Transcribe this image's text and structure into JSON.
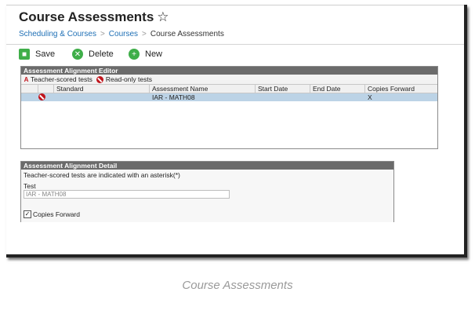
{
  "header": {
    "title": "Course Assessments",
    "star_icon": "☆",
    "breadcrumb": [
      "Scheduling & Courses",
      "Courses",
      "Course Assessments"
    ]
  },
  "toolbar": {
    "save_label": "Save",
    "delete_label": "Delete",
    "new_label": "New"
  },
  "editor": {
    "title": "Assessment Alignment Editor",
    "legend_teacher": "Teacher-scored tests",
    "legend_readonly": "Read-only tests",
    "columns": [
      "",
      "Standard",
      "Assessment Name",
      "Start Date",
      "End Date",
      "Copies Forward"
    ],
    "rows": [
      {
        "standard": "",
        "assessment_name": "IAR - MATH08",
        "start_date": "",
        "end_date": "",
        "copies_forward": "X",
        "read_only": true
      }
    ]
  },
  "detail": {
    "title": "Assessment Alignment Detail",
    "note": "Teacher-scored tests are indicated with an asterisk(*)",
    "test_label": "Test",
    "test_value": "IAR - MATH08",
    "copies_forward_label": "Copies Forward",
    "copies_forward_checked": true
  },
  "caption": "Course Assessments",
  "colors": {
    "link": "#1e6fb5",
    "panel_header": "#6b6b6b",
    "selected_row": "#bcd3e6",
    "button_green": "#3fae49",
    "readonly_red": "#c0141c"
  }
}
